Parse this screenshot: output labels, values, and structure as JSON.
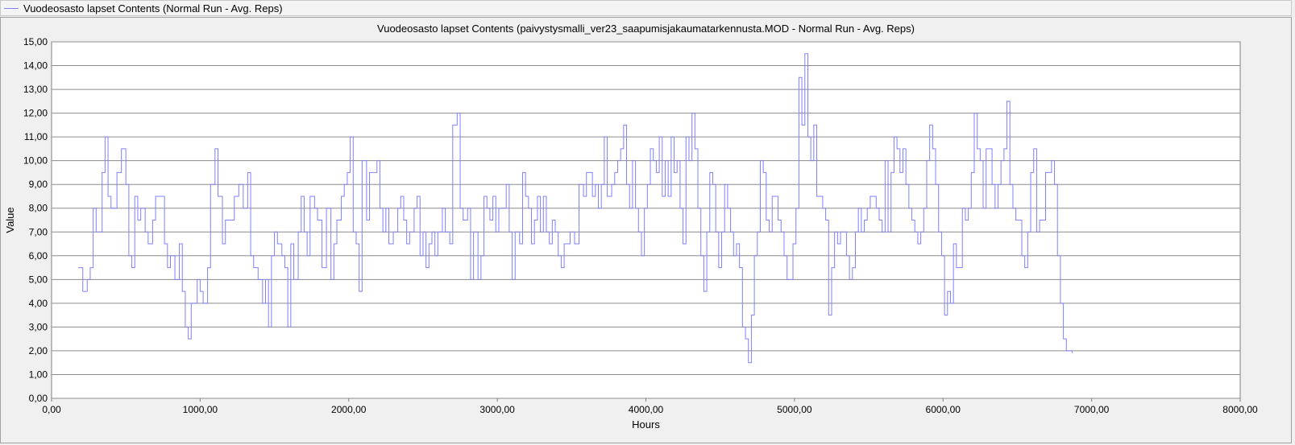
{
  "legend": {
    "label": "Vuodeosasto lapset Contents (Normal Run - Avg. Reps)",
    "color": "#8080ff"
  },
  "chart_data": {
    "type": "line",
    "title": "Vuodeosasto lapset Contents (paivystysmalli_ver23_saapumisjakaumatarkennusta.MOD - Normal Run - Avg. Reps)",
    "xlabel": "Hours",
    "ylabel": "Value",
    "xlim": [
      0,
      8000
    ],
    "ylim": [
      0,
      15
    ],
    "x_ticks": [
      "0,00",
      "1000,00",
      "2000,00",
      "3000,00",
      "4000,00",
      "5000,00",
      "6000,00",
      "7000,00",
      "8000,00"
    ],
    "y_ticks": [
      "0,00",
      "1,00",
      "2,00",
      "3,00",
      "4,00",
      "5,00",
      "6,00",
      "7,00",
      "8,00",
      "9,00",
      "10,00",
      "11,00",
      "12,00",
      "13,00",
      "14,00",
      "15,00"
    ],
    "grid": "horizontal",
    "step": true,
    "series": [
      {
        "name": "Vuodeosasto lapset Contents (Normal Run - Avg. Reps)",
        "color": "#8080ff",
        "points": [
          [
            180,
            5.5
          ],
          [
            210,
            4.5
          ],
          [
            240,
            5
          ],
          [
            260,
            5.5
          ],
          [
            280,
            8
          ],
          [
            300,
            7
          ],
          [
            340,
            9.5
          ],
          [
            360,
            11
          ],
          [
            380,
            8.5
          ],
          [
            400,
            8
          ],
          [
            440,
            9.5
          ],
          [
            470,
            10.5
          ],
          [
            500,
            9
          ],
          [
            520,
            6
          ],
          [
            540,
            5.5
          ],
          [
            560,
            8.5
          ],
          [
            580,
            7.5
          ],
          [
            600,
            8
          ],
          [
            630,
            7
          ],
          [
            650,
            6.5
          ],
          [
            680,
            7.5
          ],
          [
            700,
            8.5
          ],
          [
            730,
            8.5
          ],
          [
            760,
            6.5
          ],
          [
            780,
            5.5
          ],
          [
            800,
            6
          ],
          [
            830,
            5
          ],
          [
            860,
            6.5
          ],
          [
            880,
            4.5
          ],
          [
            900,
            3
          ],
          [
            920,
            2.5
          ],
          [
            940,
            4
          ],
          [
            960,
            4
          ],
          [
            980,
            5
          ],
          [
            1000,
            4.5
          ],
          [
            1020,
            4
          ],
          [
            1050,
            5.5
          ],
          [
            1070,
            9
          ],
          [
            1100,
            10.5
          ],
          [
            1120,
            8.5
          ],
          [
            1150,
            6.5
          ],
          [
            1170,
            7.5
          ],
          [
            1200,
            7.5
          ],
          [
            1230,
            8.5
          ],
          [
            1260,
            9
          ],
          [
            1290,
            8
          ],
          [
            1320,
            9.5
          ],
          [
            1340,
            6
          ],
          [
            1360,
            5.5
          ],
          [
            1390,
            5
          ],
          [
            1420,
            4
          ],
          [
            1440,
            5
          ],
          [
            1460,
            3
          ],
          [
            1480,
            6
          ],
          [
            1500,
            7
          ],
          [
            1520,
            6.5
          ],
          [
            1550,
            6
          ],
          [
            1570,
            5.5
          ],
          [
            1590,
            3
          ],
          [
            1610,
            6.5
          ],
          [
            1630,
            5
          ],
          [
            1660,
            7
          ],
          [
            1680,
            8.5
          ],
          [
            1700,
            7
          ],
          [
            1720,
            6
          ],
          [
            1740,
            8.5
          ],
          [
            1770,
            8
          ],
          [
            1790,
            7.5
          ],
          [
            1820,
            5.5
          ],
          [
            1850,
            8
          ],
          [
            1880,
            5
          ],
          [
            1900,
            6.5
          ],
          [
            1920,
            7.5
          ],
          [
            1950,
            8.5
          ],
          [
            1970,
            9
          ],
          [
            1990,
            9.5
          ],
          [
            2010,
            11
          ],
          [
            2030,
            7
          ],
          [
            2050,
            6.5
          ],
          [
            2070,
            4.5
          ],
          [
            2090,
            10
          ],
          [
            2120,
            7.5
          ],
          [
            2140,
            9.5
          ],
          [
            2170,
            9.5
          ],
          [
            2190,
            10
          ],
          [
            2210,
            8
          ],
          [
            2230,
            7
          ],
          [
            2250,
            8
          ],
          [
            2270,
            6.5
          ],
          [
            2300,
            7
          ],
          [
            2330,
            8
          ],
          [
            2350,
            8.5
          ],
          [
            2370,
            7.5
          ],
          [
            2390,
            6.5
          ],
          [
            2410,
            7
          ],
          [
            2440,
            8
          ],
          [
            2460,
            8.5
          ],
          [
            2480,
            6
          ],
          [
            2500,
            7
          ],
          [
            2520,
            5.5
          ],
          [
            2540,
            6.5
          ],
          [
            2560,
            7
          ],
          [
            2580,
            6
          ],
          [
            2600,
            7
          ],
          [
            2630,
            8
          ],
          [
            2650,
            7
          ],
          [
            2680,
            6.5
          ],
          [
            2700,
            11.5
          ],
          [
            2730,
            12
          ],
          [
            2750,
            8
          ],
          [
            2770,
            7.5
          ],
          [
            2800,
            8
          ],
          [
            2820,
            5
          ],
          [
            2840,
            7
          ],
          [
            2870,
            5
          ],
          [
            2890,
            6
          ],
          [
            2910,
            8.5
          ],
          [
            2930,
            8
          ],
          [
            2950,
            7.5
          ],
          [
            2970,
            8.5
          ],
          [
            2990,
            7
          ],
          [
            3010,
            8
          ],
          [
            3040,
            8
          ],
          [
            3060,
            9
          ],
          [
            3080,
            7
          ],
          [
            3100,
            5
          ],
          [
            3120,
            7
          ],
          [
            3150,
            6.5
          ],
          [
            3170,
            9.5
          ],
          [
            3190,
            8.5
          ],
          [
            3210,
            8
          ],
          [
            3230,
            6.5
          ],
          [
            3250,
            7.5
          ],
          [
            3270,
            8.5
          ],
          [
            3290,
            7
          ],
          [
            3310,
            8.5
          ],
          [
            3330,
            7
          ],
          [
            3350,
            6.5
          ],
          [
            3370,
            7.5
          ],
          [
            3390,
            7
          ],
          [
            3410,
            6
          ],
          [
            3430,
            5.5
          ],
          [
            3450,
            6.5
          ],
          [
            3470,
            6.5
          ],
          [
            3490,
            7
          ],
          [
            3520,
            6.5
          ],
          [
            3550,
            9
          ],
          [
            3580,
            8.5
          ],
          [
            3600,
            9.5
          ],
          [
            3640,
            8.5
          ],
          [
            3660,
            9
          ],
          [
            3680,
            8
          ],
          [
            3700,
            9
          ],
          [
            3720,
            11
          ],
          [
            3740,
            8.5
          ],
          [
            3770,
            9
          ],
          [
            3790,
            9.5
          ],
          [
            3810,
            10
          ],
          [
            3830,
            10.5
          ],
          [
            3850,
            11.5
          ],
          [
            3870,
            9
          ],
          [
            3890,
            8
          ],
          [
            3910,
            10
          ],
          [
            3930,
            8
          ],
          [
            3950,
            7
          ],
          [
            3970,
            6
          ],
          [
            3990,
            8
          ],
          [
            4010,
            9
          ],
          [
            4030,
            10.5
          ],
          [
            4050,
            10
          ],
          [
            4070,
            9.5
          ],
          [
            4090,
            11
          ],
          [
            4110,
            8.5
          ],
          [
            4130,
            10
          ],
          [
            4150,
            8.5
          ],
          [
            4170,
            11
          ],
          [
            4190,
            9.5
          ],
          [
            4210,
            10
          ],
          [
            4230,
            8
          ],
          [
            4250,
            6.5
          ],
          [
            4270,
            11
          ],
          [
            4290,
            10
          ],
          [
            4310,
            12
          ],
          [
            4330,
            10.5
          ],
          [
            4350,
            8
          ],
          [
            4370,
            6
          ],
          [
            4390,
            4.5
          ],
          [
            4410,
            7
          ],
          [
            4430,
            9.5
          ],
          [
            4450,
            9
          ],
          [
            4470,
            7
          ],
          [
            4490,
            5.5
          ],
          [
            4510,
            7
          ],
          [
            4530,
            9
          ],
          [
            4550,
            8
          ],
          [
            4570,
            7
          ],
          [
            4590,
            6
          ],
          [
            4610,
            6.5
          ],
          [
            4630,
            5.5
          ],
          [
            4650,
            3
          ],
          [
            4670,
            2.5
          ],
          [
            4690,
            1.5
          ],
          [
            4710,
            3.5
          ],
          [
            4730,
            6
          ],
          [
            4750,
            7
          ],
          [
            4770,
            10
          ],
          [
            4790,
            9.5
          ],
          [
            4810,
            7.5
          ],
          [
            4830,
            7
          ],
          [
            4850,
            8.5
          ],
          [
            4870,
            8.5
          ],
          [
            4890,
            7.5
          ],
          [
            4910,
            7
          ],
          [
            4930,
            6
          ],
          [
            4950,
            5
          ],
          [
            4970,
            5
          ],
          [
            4990,
            6.5
          ],
          [
            5010,
            8
          ],
          [
            5030,
            13.5
          ],
          [
            5050,
            11.5
          ],
          [
            5070,
            14.5
          ],
          [
            5090,
            11
          ],
          [
            5110,
            10
          ],
          [
            5130,
            11.5
          ],
          [
            5150,
            8.5
          ],
          [
            5170,
            8.5
          ],
          [
            5190,
            8
          ],
          [
            5210,
            7.5
          ],
          [
            5230,
            3.5
          ],
          [
            5250,
            5.5
          ],
          [
            5270,
            7
          ],
          [
            5290,
            6.5
          ],
          [
            5310,
            7
          ],
          [
            5330,
            7
          ],
          [
            5350,
            6
          ],
          [
            5370,
            5
          ],
          [
            5390,
            5.5
          ],
          [
            5410,
            7
          ],
          [
            5430,
            8
          ],
          [
            5450,
            7
          ],
          [
            5470,
            7.5
          ],
          [
            5490,
            8
          ],
          [
            5510,
            8.5
          ],
          [
            5530,
            8.5
          ],
          [
            5550,
            8
          ],
          [
            5570,
            7.5
          ],
          [
            5590,
            7
          ],
          [
            5610,
            10
          ],
          [
            5630,
            7
          ],
          [
            5650,
            9.5
          ],
          [
            5670,
            11
          ],
          [
            5690,
            10.5
          ],
          [
            5710,
            9.5
          ],
          [
            5730,
            10.5
          ],
          [
            5750,
            9
          ],
          [
            5770,
            8
          ],
          [
            5790,
            7.5
          ],
          [
            5810,
            7
          ],
          [
            5830,
            6.5
          ],
          [
            5850,
            7
          ],
          [
            5870,
            8
          ],
          [
            5890,
            10
          ],
          [
            5910,
            11.5
          ],
          [
            5930,
            10.5
          ],
          [
            5950,
            9
          ],
          [
            5970,
            7
          ],
          [
            5990,
            6
          ],
          [
            6010,
            3.5
          ],
          [
            6030,
            4.5
          ],
          [
            6050,
            4
          ],
          [
            6070,
            6.5
          ],
          [
            6090,
            5.5
          ],
          [
            6110,
            5.5
          ],
          [
            6130,
            8
          ],
          [
            6150,
            7.5
          ],
          [
            6170,
            8
          ],
          [
            6190,
            9.5
          ],
          [
            6210,
            12
          ],
          [
            6230,
            10.5
          ],
          [
            6250,
            10
          ],
          [
            6270,
            8
          ],
          [
            6290,
            10.5
          ],
          [
            6310,
            10.5
          ],
          [
            6330,
            9
          ],
          [
            6350,
            8
          ],
          [
            6370,
            9
          ],
          [
            6390,
            10
          ],
          [
            6410,
            10.5
          ],
          [
            6430,
            12.5
          ],
          [
            6450,
            9
          ],
          [
            6470,
            8
          ],
          [
            6490,
            7.5
          ],
          [
            6510,
            7.5
          ],
          [
            6530,
            6
          ],
          [
            6550,
            5.5
          ],
          [
            6570,
            7
          ],
          [
            6590,
            9.5
          ],
          [
            6610,
            10.5
          ],
          [
            6630,
            7
          ],
          [
            6650,
            7.5
          ],
          [
            6670,
            7.5
          ],
          [
            6690,
            9.5
          ],
          [
            6710,
            9.5
          ],
          [
            6730,
            10
          ],
          [
            6750,
            9
          ],
          [
            6770,
            6
          ],
          [
            6790,
            4
          ],
          [
            6810,
            2.5
          ],
          [
            6830,
            2
          ],
          [
            6870,
            1.9
          ]
        ]
      }
    ]
  }
}
